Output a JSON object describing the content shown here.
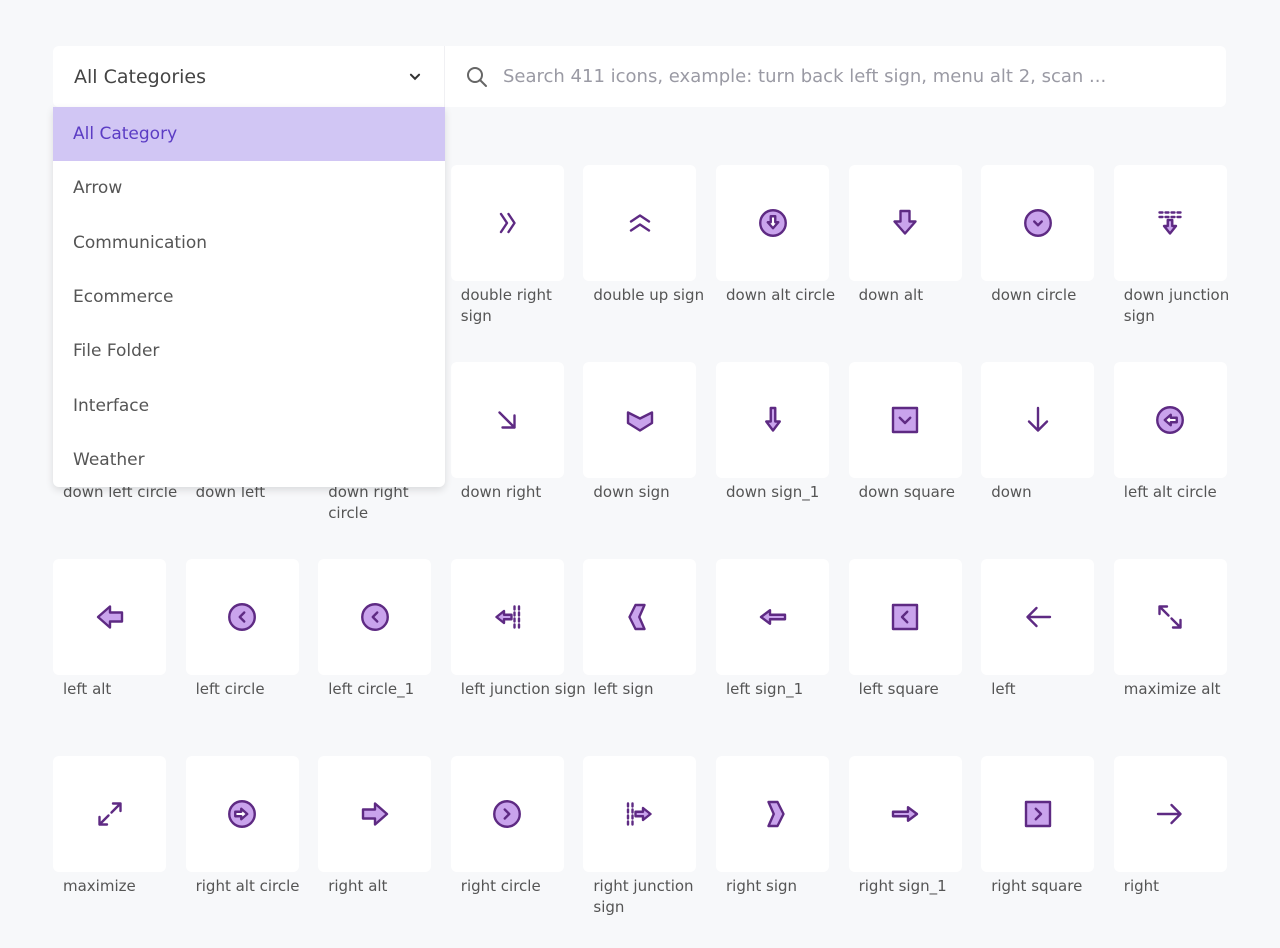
{
  "colors": {
    "stroke": "#5e2a83",
    "fill": "#c9a3ec",
    "selected_bg": "#d1c6f4",
    "selected_text": "#5b3cc4"
  },
  "category_select": {
    "value": "All Categories",
    "icon": "chevron-down-icon"
  },
  "search": {
    "placeholder": "Search 411 icons, example: turn back left sign, menu alt 2, scan ...",
    "icon": "search-icon"
  },
  "dropdown": {
    "options": [
      "All Category",
      "Arrow",
      "Communication",
      "Ecommerce",
      "File Folder",
      "Interface",
      "Weather"
    ],
    "selected": 0
  },
  "rows": [
    [
      null,
      null,
      null,
      {
        "label": "double right sign",
        "icon": "double-right"
      },
      {
        "label": "double up sign",
        "icon": "double-up"
      },
      {
        "label": "down alt circle",
        "icon": "down-alt-circle"
      },
      {
        "label": "down alt",
        "icon": "down-alt"
      },
      {
        "label": "down circle",
        "icon": "down-circle"
      },
      {
        "label": "down junction sign",
        "icon": "down-junction"
      }
    ],
    [
      {
        "label": "down left circle",
        "icon": "down-left-circle"
      },
      {
        "label": "down left",
        "icon": "down-left"
      },
      {
        "label": "down right circle",
        "icon": "down-right-circle"
      },
      {
        "label": "down right",
        "icon": "down-right"
      },
      {
        "label": "down sign",
        "icon": "down-sign"
      },
      {
        "label": "down sign_1",
        "icon": "down-sign-1"
      },
      {
        "label": "down square",
        "icon": "down-square"
      },
      {
        "label": "down",
        "icon": "down"
      },
      {
        "label": "left alt circle",
        "icon": "left-alt-circle"
      }
    ],
    [
      {
        "label": "left alt",
        "icon": "left-alt"
      },
      {
        "label": "left circle",
        "icon": "left-circle"
      },
      {
        "label": "left circle_1",
        "icon": "left-circle"
      },
      {
        "label": "left junction sign",
        "icon": "left-junction"
      },
      {
        "label": "left sign",
        "icon": "left-sign"
      },
      {
        "label": "left sign_1",
        "icon": "left-sign-1"
      },
      {
        "label": "left square",
        "icon": "left-square"
      },
      {
        "label": "left",
        "icon": "left"
      },
      {
        "label": "maximize alt",
        "icon": "maximize-alt"
      }
    ],
    [
      {
        "label": "maximize",
        "icon": "maximize"
      },
      {
        "label": "right alt circle",
        "icon": "right-alt-circle"
      },
      {
        "label": "right alt",
        "icon": "right-alt"
      },
      {
        "label": "right circle",
        "icon": "right-circle"
      },
      {
        "label": "right junction sign",
        "icon": "right-junction"
      },
      {
        "label": "right sign",
        "icon": "right-sign"
      },
      {
        "label": "right sign_1",
        "icon": "right-sign-1"
      },
      {
        "label": "right square",
        "icon": "right-square"
      },
      {
        "label": "right",
        "icon": "right"
      }
    ]
  ]
}
